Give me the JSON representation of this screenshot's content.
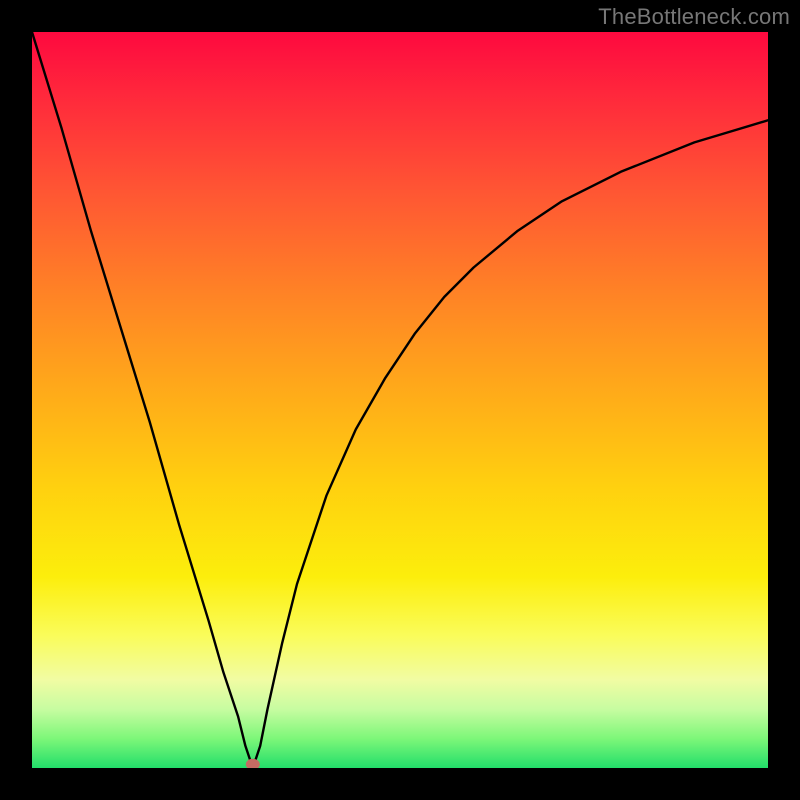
{
  "watermark": "TheBottleneck.com",
  "chart_data": {
    "type": "line",
    "title": "",
    "xlabel": "",
    "ylabel": "",
    "xlim": [
      0,
      100
    ],
    "ylim": [
      0,
      100
    ],
    "x": [
      0,
      4,
      8,
      12,
      16,
      20,
      24,
      26,
      28,
      29,
      30,
      31,
      32,
      34,
      36,
      40,
      44,
      48,
      52,
      56,
      60,
      66,
      72,
      80,
      90,
      100
    ],
    "values": [
      100,
      87,
      73,
      60,
      47,
      33,
      20,
      13,
      7,
      3,
      0,
      3,
      8,
      17,
      25,
      37,
      46,
      53,
      59,
      64,
      68,
      73,
      77,
      81,
      85,
      88
    ],
    "marker": {
      "x": 30,
      "y": 0.5
    },
    "background_gradient": [
      "#fe093f",
      "#ff5733",
      "#ffa81a",
      "#fcee0c",
      "#7df779",
      "#22de6a"
    ]
  }
}
